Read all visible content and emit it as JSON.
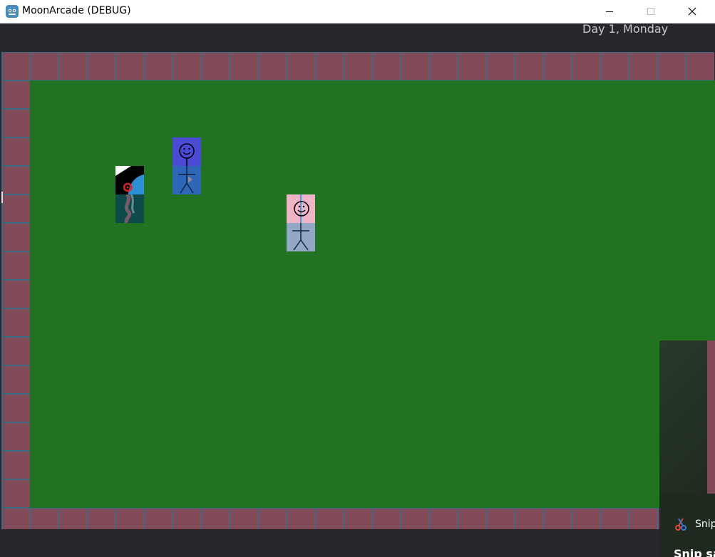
{
  "window": {
    "title": "MoonArcade (DEBUG)",
    "icon": "godot-engine-icon",
    "controls": {
      "minimize": "minimize-icon",
      "maximize": "maximize-icon",
      "close": "close-icon"
    }
  },
  "hud": {
    "date": "Day 1, Monday"
  },
  "world": {
    "wall_color": "#814a58",
    "wall_border_color": "#3d6b84",
    "floor_color": "#217321",
    "characters": [
      {
        "id": "dark",
        "head_color": "#000000",
        "body_color": "#0f4a4a"
      },
      {
        "id": "blue",
        "head_color": "#4a4ad4",
        "body_color": "#2e66b8"
      },
      {
        "id": "pink",
        "head_color": "#f0b4c8",
        "body_color": "#93a8c4"
      }
    ]
  },
  "snip_notification": {
    "app_label": "Snip",
    "message": "Snip sa",
    "icon": "snip-sketch-icon"
  }
}
